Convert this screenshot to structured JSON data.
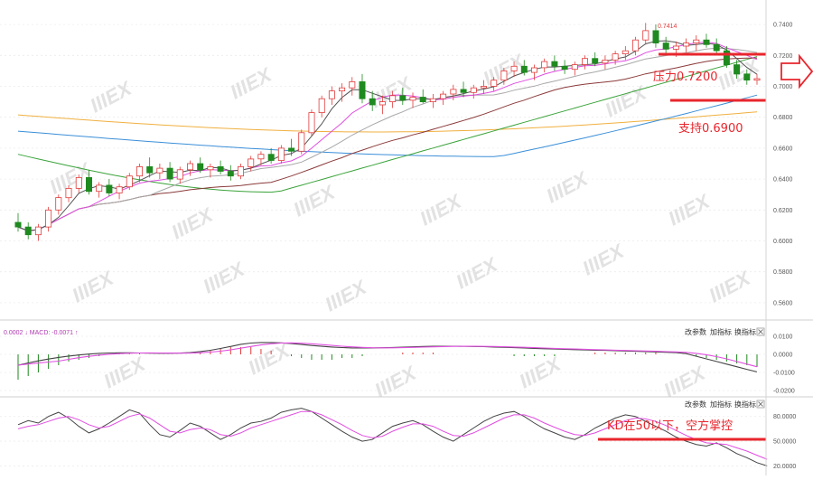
{
  "colors": {
    "up": "#e23b3b",
    "down": "#1f8a1f",
    "annotation": "#e8262d",
    "ma_short": "#555555",
    "ma_mid": "#e04ee0",
    "ma_gray": "#a8a8a8",
    "ma_brown": "#8b3a3a",
    "ma_green": "#3aa33a",
    "ma_blue": "#3b8fd8",
    "ma_orange": "#f0b040",
    "k_line": "#444444",
    "d_line": "#e04ee0",
    "watermark": "#e2e2e2"
  },
  "main_panel": {
    "peak_label": "0.7414",
    "annotations": {
      "resistance": "压力0.7200",
      "support": "支持0.6900"
    },
    "right_arrow_icon": "hollow-right-arrow"
  },
  "macd_panel": {
    "header_left": "0.0002 ↓ MACD: -0.0071 ↑",
    "controls": [
      "改参数",
      "加指标",
      "换指标"
    ],
    "close_icon": "close-icon"
  },
  "kd_panel": {
    "controls": [
      "改参数",
      "加指标",
      "换指标"
    ],
    "close_icon": "close-icon",
    "annotation": "KD在50以下，空方掌控"
  },
  "watermark_text": "IIIEX",
  "chart_data": [
    {
      "type": "candlestick",
      "ylim": [
        0.55,
        0.75
      ],
      "yticks": [
        "0.7400",
        "0.7200",
        "0.7000",
        "0.6800",
        "0.6600",
        "0.6400",
        "0.6200",
        "0.6000",
        "0.5800",
        "0.5600"
      ],
      "ohlc": [
        [
          0.612,
          0.618,
          0.606,
          0.609
        ],
        [
          0.609,
          0.612,
          0.601,
          0.604
        ],
        [
          0.604,
          0.611,
          0.6,
          0.609
        ],
        [
          0.609,
          0.622,
          0.606,
          0.62
        ],
        [
          0.62,
          0.63,
          0.617,
          0.628
        ],
        [
          0.628,
          0.636,
          0.625,
          0.634
        ],
        [
          0.634,
          0.643,
          0.631,
          0.641
        ],
        [
          0.641,
          0.646,
          0.63,
          0.632
        ],
        [
          0.632,
          0.638,
          0.628,
          0.636
        ],
        [
          0.636,
          0.64,
          0.629,
          0.631
        ],
        [
          0.631,
          0.637,
          0.627,
          0.635
        ],
        [
          0.635,
          0.644,
          0.633,
          0.642
        ],
        [
          0.642,
          0.65,
          0.638,
          0.648
        ],
        [
          0.648,
          0.654,
          0.641,
          0.644
        ],
        [
          0.644,
          0.65,
          0.64,
          0.647
        ],
        [
          0.647,
          0.651,
          0.638,
          0.64
        ],
        [
          0.64,
          0.648,
          0.637,
          0.646
        ],
        [
          0.646,
          0.652,
          0.642,
          0.65
        ],
        [
          0.65,
          0.654,
          0.644,
          0.646
        ],
        [
          0.646,
          0.65,
          0.641,
          0.648
        ],
        [
          0.648,
          0.652,
          0.643,
          0.645
        ],
        [
          0.645,
          0.649,
          0.639,
          0.642
        ],
        [
          0.642,
          0.65,
          0.64,
          0.648
        ],
        [
          0.648,
          0.655,
          0.645,
          0.653
        ],
        [
          0.653,
          0.658,
          0.649,
          0.656
        ],
        [
          0.656,
          0.66,
          0.65,
          0.652
        ],
        [
          0.652,
          0.662,
          0.65,
          0.66
        ],
        [
          0.66,
          0.666,
          0.655,
          0.658
        ],
        [
          0.658,
          0.672,
          0.656,
          0.67
        ],
        [
          0.67,
          0.685,
          0.668,
          0.683
        ],
        [
          0.683,
          0.694,
          0.68,
          0.692
        ],
        [
          0.692,
          0.7,
          0.688,
          0.697
        ],
        [
          0.697,
          0.702,
          0.69,
          0.699
        ],
        [
          0.699,
          0.706,
          0.694,
          0.703
        ],
        [
          0.703,
          0.708,
          0.689,
          0.692
        ],
        [
          0.692,
          0.697,
          0.684,
          0.688
        ],
        [
          0.688,
          0.694,
          0.682,
          0.69
        ],
        [
          0.69,
          0.697,
          0.686,
          0.694
        ],
        [
          0.694,
          0.699,
          0.688,
          0.691
        ],
        [
          0.691,
          0.696,
          0.686,
          0.693
        ],
        [
          0.693,
          0.698,
          0.689,
          0.69
        ],
        [
          0.69,
          0.695,
          0.686,
          0.692
        ],
        [
          0.692,
          0.697,
          0.688,
          0.695
        ],
        [
          0.695,
          0.701,
          0.691,
          0.698
        ],
        [
          0.698,
          0.703,
          0.693,
          0.696
        ],
        [
          0.696,
          0.701,
          0.692,
          0.699
        ],
        [
          0.699,
          0.704,
          0.695,
          0.7
        ],
        [
          0.7,
          0.706,
          0.697,
          0.704
        ],
        [
          0.704,
          0.712,
          0.701,
          0.71
        ],
        [
          0.71,
          0.716,
          0.706,
          0.713
        ],
        [
          0.713,
          0.717,
          0.707,
          0.709
        ],
        [
          0.709,
          0.714,
          0.704,
          0.712
        ],
        [
          0.712,
          0.718,
          0.709,
          0.716
        ],
        [
          0.716,
          0.72,
          0.71,
          0.713
        ],
        [
          0.713,
          0.717,
          0.708,
          0.711
        ],
        [
          0.711,
          0.716,
          0.707,
          0.714
        ],
        [
          0.714,
          0.72,
          0.711,
          0.718
        ],
        [
          0.718,
          0.722,
          0.713,
          0.715
        ],
        [
          0.715,
          0.72,
          0.711,
          0.717
        ],
        [
          0.717,
          0.723,
          0.714,
          0.721
        ],
        [
          0.721,
          0.726,
          0.717,
          0.723
        ],
        [
          0.723,
          0.732,
          0.72,
          0.73
        ],
        [
          0.73,
          0.741,
          0.727,
          0.736
        ],
        [
          0.736,
          0.74,
          0.725,
          0.728
        ],
        [
          0.728,
          0.732,
          0.721,
          0.724
        ],
        [
          0.724,
          0.729,
          0.719,
          0.726
        ],
        [
          0.726,
          0.731,
          0.722,
          0.728
        ],
        [
          0.728,
          0.733,
          0.723,
          0.73
        ],
        [
          0.73,
          0.734,
          0.725,
          0.727
        ],
        [
          0.727,
          0.731,
          0.721,
          0.723
        ],
        [
          0.723,
          0.726,
          0.712,
          0.714
        ],
        [
          0.714,
          0.717,
          0.705,
          0.708
        ],
        [
          0.708,
          0.711,
          0.701,
          0.704
        ],
        [
          0.704,
          0.708,
          0.701,
          0.705
        ]
      ]
    },
    {
      "type": "bar",
      "ylim": [
        -0.022,
        0.016
      ],
      "yticks": [
        "0.0100",
        "0.0000",
        "-0.0100",
        "-0.0200"
      ],
      "values": [
        -0.014,
        -0.012,
        -0.01,
        -0.008,
        -0.006,
        -0.004,
        -0.003,
        -0.002,
        -0.001,
        0.0,
        0.001,
        0.001,
        0.001,
        0.0,
        0.0,
        0.0,
        0.0,
        0.0,
        0.001,
        0.002,
        0.003,
        0.004,
        0.004,
        0.004,
        0.003,
        0.002,
        0.0,
        -0.001,
        -0.002,
        -0.003,
        -0.003,
        -0.003,
        -0.002,
        -0.002,
        -0.001,
        0.0,
        0.0,
        0.0,
        0.001,
        0.001,
        0.001,
        0.001,
        0.0,
        0.0,
        0.0,
        0.0,
        0.0,
        0.0,
        0.0,
        -0.001,
        -0.001,
        -0.001,
        -0.001,
        -0.001,
        0.0,
        0.0,
        0.0,
        0.001,
        0.001,
        0.001,
        0.001,
        0.001,
        0.001,
        0.001,
        0.0,
        0.0,
        0.0,
        -0.001,
        -0.002,
        -0.003,
        -0.004,
        -0.005,
        -0.006,
        -0.007
      ]
    },
    {
      "type": "line",
      "ylim": [
        15,
        95
      ],
      "yticks": [
        "80.0000",
        "50.0000",
        "20.0000"
      ],
      "series": [
        {
          "values": [
            70,
            75,
            72,
            80,
            85,
            78,
            68,
            60,
            65,
            72,
            80,
            88,
            84,
            70,
            58,
            55,
            63,
            72,
            68,
            60,
            52,
            58,
            66,
            72,
            74,
            78,
            85,
            88,
            90,
            86,
            78,
            70,
            62,
            55,
            50,
            52,
            60,
            68,
            72,
            75,
            70,
            62,
            55,
            50,
            58,
            66,
            74,
            80,
            84,
            86,
            80,
            72,
            65,
            60,
            55,
            52,
            58,
            66,
            72,
            78,
            82,
            80,
            74,
            68,
            62,
            55,
            50,
            46,
            44,
            48,
            42,
            35,
            30,
            24,
            20
          ]
        },
        {
          "values": [
            65,
            68,
            70,
            74,
            78,
            80,
            76,
            70,
            66,
            68,
            74,
            80,
            83,
            78,
            70,
            62,
            60,
            64,
            66,
            64,
            58,
            56,
            60,
            66,
            70,
            74,
            78,
            82,
            86,
            86,
            82,
            76,
            70,
            63,
            57,
            54,
            56,
            62,
            67,
            71,
            71,
            68,
            62,
            57,
            56,
            60,
            66,
            72,
            78,
            82,
            82,
            78,
            72,
            67,
            62,
            58,
            57,
            60,
            65,
            70,
            75,
            78,
            77,
            74,
            69,
            63,
            57,
            52,
            48,
            47,
            46,
            42,
            38,
            33,
            28
          ]
        }
      ]
    }
  ]
}
